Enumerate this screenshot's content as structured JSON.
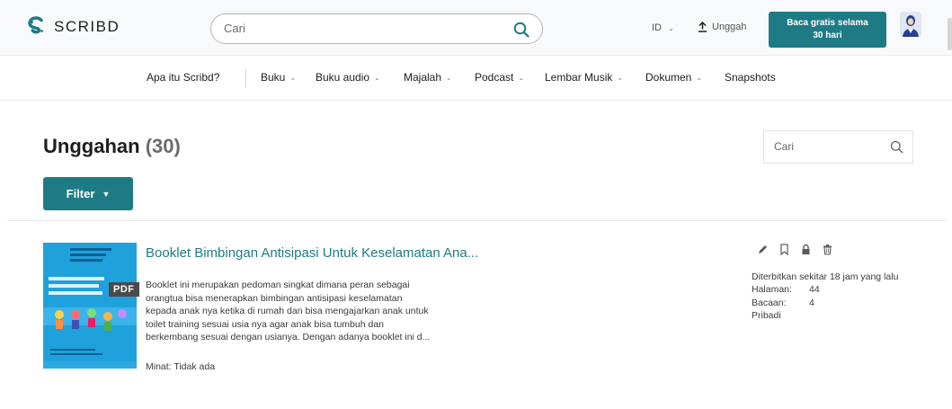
{
  "header": {
    "logo_text": "SCRIBD",
    "search_placeholder": "Cari",
    "lang": "ID",
    "upload_label": "Unggah",
    "cta_line1": "Baca gratis selama",
    "cta_line2": "30 hari",
    "accent_color": "#1e7b85"
  },
  "nav": {
    "about": "Apa itu Scribd?",
    "items": [
      "Buku",
      "Buku audio",
      "Majalah",
      "Podcast",
      "Lembar Musik",
      "Dokumen",
      "Snapshots"
    ]
  },
  "page": {
    "title": "Unggahan",
    "count": "(30)",
    "search_placeholder": "Cari",
    "filter_label": "Filter"
  },
  "document": {
    "badge": "PDF",
    "title": "Booklet Bimbingan Antisipasi Untuk Keselamatan Ana...",
    "description_lines": [
      "Booklet ini merupakan pedoman singkat dimana peran sebagai",
      "orangtua bisa menerapkan bimbingan antisipasi keselamatan",
      "kepada anak nya ketika di rumah dan bisa mengajarkan anak untuk",
      "toilet training sesuai usia nya agar anak bisa tumbuh dan",
      "berkembang sesuai dengan usianya. Dengan adanya booklet ini d..."
    ],
    "interest": "Minat: Tidak ada",
    "published": "Diterbitkan sekitar 18 jam yang lalu",
    "pages_label": "Halaman:",
    "pages_value": "44",
    "reads_label": "Bacaan:",
    "reads_value": "4",
    "visibility": "Pribadi"
  }
}
